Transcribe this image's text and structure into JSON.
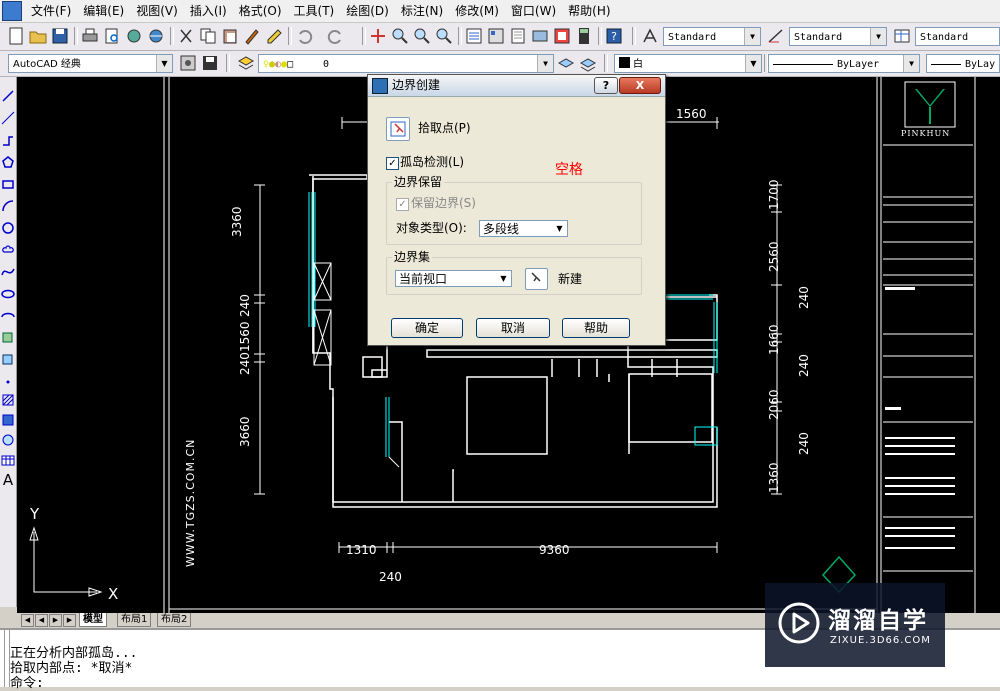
{
  "menubar": {
    "items": [
      "文件(F)",
      "编辑(E)",
      "视图(V)",
      "插入(I)",
      "格式(O)",
      "工具(T)",
      "绘图(D)",
      "标注(N)",
      "修改(M)",
      "窗口(W)",
      "帮助(H)"
    ]
  },
  "toolbar1": {
    "text_style": "Standard",
    "dim_style": "Standard",
    "table_style": "Standard"
  },
  "toolbar2": {
    "workspace": "AutoCAD 经典",
    "layer_value": "0",
    "color_value": "白",
    "linetype": "ByLayer",
    "lineweight": "ByLay"
  },
  "dialog": {
    "title": "边界创建",
    "help_glyph": "?",
    "close_glyph": "X",
    "pick_points": "拾取点(P)",
    "island_detection": "孤岛检测(L)",
    "annotation": "空格",
    "boundary_retention": "边界保留",
    "retain_boundaries": "保留边界(S)",
    "object_type_label": "对象类型(O):",
    "object_type_value": "多段线",
    "boundary_set": "边界集",
    "boundary_set_value": "当前视口",
    "new_label": "新建",
    "ok": "确定",
    "cancel": "取消",
    "help": "帮助"
  },
  "drawing": {
    "dims": {
      "top_1560": "1560",
      "left_3360": "3360",
      "left_240a": "240",
      "left_1560": "1560",
      "left_240b": "240",
      "left_3660": "3660",
      "right_1700": "1700",
      "right_2560": "2560",
      "right_240a": "240",
      "right_1660": "1660",
      "right_240b": "240",
      "right_2060": "2060",
      "right_240c": "240",
      "right_1360": "1360",
      "bottom_1310": "1310",
      "bottom_9360": "9360",
      "bottom_240": "240"
    },
    "vertical_watermark": "WWW.TGZS.COM.CN",
    "ucs_y": "Y",
    "ucs_x": "X",
    "title_block_brand": "PINKHUN"
  },
  "tabs": {
    "model": "模型",
    "layout1": "布局1",
    "layout2": "布局2"
  },
  "command": {
    "line1": "正在分析内部孤岛...",
    "line2": "拾取内部点:  *取消*",
    "line3": "命令:"
  },
  "watermark": {
    "name": "溜溜自学",
    "url": "ZIXUE.3D66.COM"
  },
  "colors": {
    "canvas_bg": "#000000",
    "wall": "#ffffff",
    "window": "#00ffff",
    "annotation_red": "#ff0000",
    "title_block_green": "#00aa66"
  }
}
